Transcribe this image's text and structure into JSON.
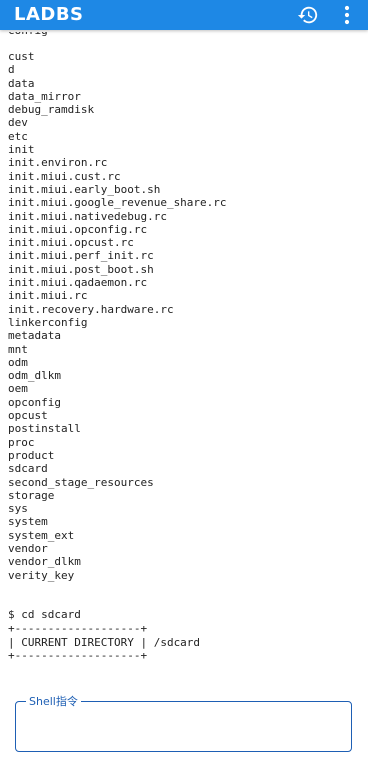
{
  "app_bar": {
    "title": "LADBS",
    "color": "#1e88e5",
    "icons": [
      "history-icon",
      "more-vert-icon"
    ]
  },
  "terminal": {
    "clipped_top_line": "config",
    "listing": [
      "cust",
      "d",
      "data",
      "data_mirror",
      "debug_ramdisk",
      "dev",
      "etc",
      "init",
      "init.environ.rc",
      "init.miui.cust.rc",
      "init.miui.early_boot.sh",
      "init.miui.google_revenue_share.rc",
      "init.miui.nativedebug.rc",
      "init.miui.opconfig.rc",
      "init.miui.opcust.rc",
      "init.miui.perf_init.rc",
      "init.miui.post_boot.sh",
      "init.miui.qadaemon.rc",
      "init.miui.rc",
      "init.recovery.hardware.rc",
      "linkerconfig",
      "metadata",
      "mnt",
      "odm",
      "odm_dlkm",
      "oem",
      "opconfig",
      "opcust",
      "postinstall",
      "proc",
      "product",
      "sdcard",
      "second_stage_resources",
      "storage",
      "sys",
      "system",
      "system_ext",
      "vendor",
      "vendor_dlkm",
      "verity_key"
    ],
    "command": "$ cd sdcard",
    "table_border": "+-------------------+",
    "table_row": "| CURRENT DIRECTORY | /sdcard"
  },
  "shell": {
    "label": "Shell指令",
    "value": "",
    "accent": "#1e5fb4"
  }
}
